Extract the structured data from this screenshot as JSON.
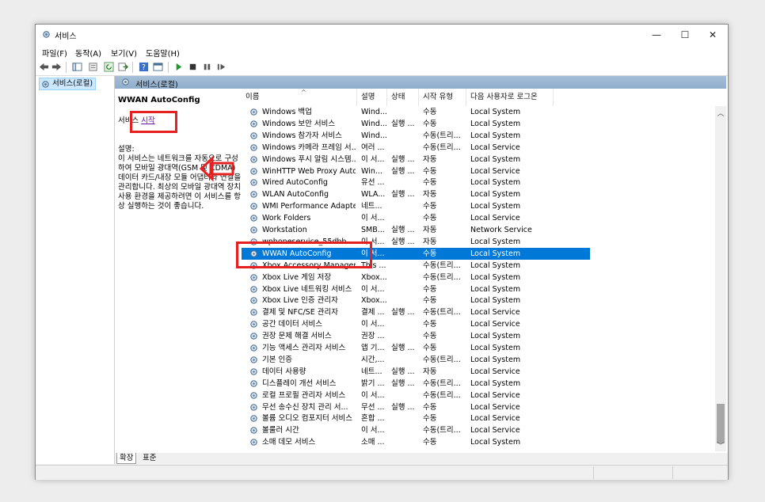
{
  "window": {
    "title": "서비스",
    "minimize": "—",
    "maximize": "☐",
    "close": "✕"
  },
  "menu": [
    "파일(F)",
    "동작(A)",
    "보기(V)",
    "도움말(H)"
  ],
  "tree": {
    "item": "서비스(로컬)"
  },
  "content_header": "서비스(로컬)",
  "detail": {
    "service_name": "WWAN AutoConfig",
    "action_prefix": "서비스 ",
    "action_link": "시작",
    "description_label": "설명:",
    "description": "이 서비스는 네트워크를 자동으로 구성하여 모바일 광대역(GSM 및 CDMA) 데이터 카드/내장 모듈 어댑터와 연결을 관리합니다. 최상의 모바일 광대역 장치 사용 환경을 제공하려면 이 서비스를 항상 실행하는 것이 좋습니다."
  },
  "columns": [
    "이름",
    "설명",
    "상태",
    "시작 유형",
    "다음 사용자로 로그온"
  ],
  "sort_indicator": "^",
  "rows": [
    {
      "name": "Windows 백업",
      "desc": "Wind...",
      "status": "",
      "startup": "수동",
      "logon": "Local System"
    },
    {
      "name": "Windows 보안 서비스",
      "desc": "Wind...",
      "status": "실행 ...",
      "startup": "수동",
      "logon": "Local System"
    },
    {
      "name": "Windows 참가자 서비스",
      "desc": "Wind...",
      "status": "",
      "startup": "수동(트리...",
      "logon": "Local System"
    },
    {
      "name": "Windows 카메라 프레임 서...",
      "desc": "여러 ...",
      "status": "",
      "startup": "수동(트리...",
      "logon": "Local Service"
    },
    {
      "name": "Windows 푸시 알림 시스템...",
      "desc": "이 서...",
      "status": "실행 ...",
      "startup": "자동",
      "logon": "Local System"
    },
    {
      "name": "WinHTTP Web Proxy Auto-...",
      "desc": "Win...",
      "status": "실행 ...",
      "startup": "수동",
      "logon": "Local Service"
    },
    {
      "name": "Wired AutoConfig",
      "desc": "유선 ...",
      "status": "",
      "startup": "수동",
      "logon": "Local System"
    },
    {
      "name": "WLAN AutoConfig",
      "desc": "WLA...",
      "status": "실행 ...",
      "startup": "자동",
      "logon": "Local System"
    },
    {
      "name": "WMI Performance Adapter",
      "desc": "네트...",
      "status": "",
      "startup": "수동",
      "logon": "Local System"
    },
    {
      "name": "Work Folders",
      "desc": "이 서...",
      "status": "",
      "startup": "수동",
      "logon": "Local Service"
    },
    {
      "name": "Workstation",
      "desc": "SMB...",
      "status": "실행 ...",
      "startup": "자동",
      "logon": "Network Service"
    },
    {
      "name": "wphoneservice_55dbb",
      "desc": "이 서...",
      "status": "실행 ...",
      "startup": "자동",
      "logon": "Local System"
    },
    {
      "name": "WWAN AutoConfig",
      "desc": "이 서...",
      "status": "",
      "startup": "수동",
      "logon": "Local System"
    },
    {
      "name": "Xbox Accessory Managem...",
      "desc": "This ...",
      "status": "",
      "startup": "수동(트리...",
      "logon": "Local System"
    },
    {
      "name": "Xbox Live 게임 저장",
      "desc": "Xbox...",
      "status": "",
      "startup": "수동(트리...",
      "logon": "Local System"
    },
    {
      "name": "Xbox Live 네트워킹 서비스",
      "desc": "이 서...",
      "status": "",
      "startup": "수동",
      "logon": "Local System"
    },
    {
      "name": "Xbox Live 인증 관리자",
      "desc": "Xbox...",
      "status": "",
      "startup": "수동",
      "logon": "Local System"
    },
    {
      "name": "결제 및 NFC/SE 관리자",
      "desc": "결제 ...",
      "status": "실행 ...",
      "startup": "수동(트리...",
      "logon": "Local Service"
    },
    {
      "name": "공간 데이터 서비스",
      "desc": "이 서...",
      "status": "",
      "startup": "수동",
      "logon": "Local Service"
    },
    {
      "name": "권장 문제 해결 서비스",
      "desc": "권장 ...",
      "status": "",
      "startup": "수동",
      "logon": "Local System"
    },
    {
      "name": "기능 액세스 관리자 서비스",
      "desc": "앱 기...",
      "status": "실행 ...",
      "startup": "수동",
      "logon": "Local System"
    },
    {
      "name": "기본 인증",
      "desc": "시간,...",
      "status": "",
      "startup": "수동(트리...",
      "logon": "Local System"
    },
    {
      "name": "데이터 사용량",
      "desc": "네트...",
      "status": "실행 ...",
      "startup": "자동",
      "logon": "Local Service"
    },
    {
      "name": "디스플레이 개선 서비스",
      "desc": "밝기 ...",
      "status": "실행 ...",
      "startup": "수동(트리...",
      "logon": "Local System"
    },
    {
      "name": "로컬 프로필 관리자 서비스",
      "desc": "이 서...",
      "status": "",
      "startup": "수동(트리...",
      "logon": "Local Service"
    },
    {
      "name": "무선 송수신 장치 관리 서...",
      "desc": "무선 ...",
      "status": "실행 ...",
      "startup": "수동",
      "logon": "Local Service"
    },
    {
      "name": "볼륨 오디오 컴포지터 서비스",
      "desc": "혼합 ...",
      "status": "",
      "startup": "수동",
      "logon": "Local Service"
    },
    {
      "name": "볼룰러 시간",
      "desc": "이 서...",
      "status": "",
      "startup": "수동(트리...",
      "logon": "Local Service"
    },
    {
      "name": "소매 데모 서비스",
      "desc": "소매 ...",
      "status": "",
      "startup": "수동",
      "logon": "Local System"
    }
  ],
  "selected_row": 12,
  "tabs": [
    "확장",
    "표준"
  ],
  "colors": {
    "selection": "#0078d7",
    "annotation": "#e62020",
    "header_band": "#99b4d1"
  }
}
